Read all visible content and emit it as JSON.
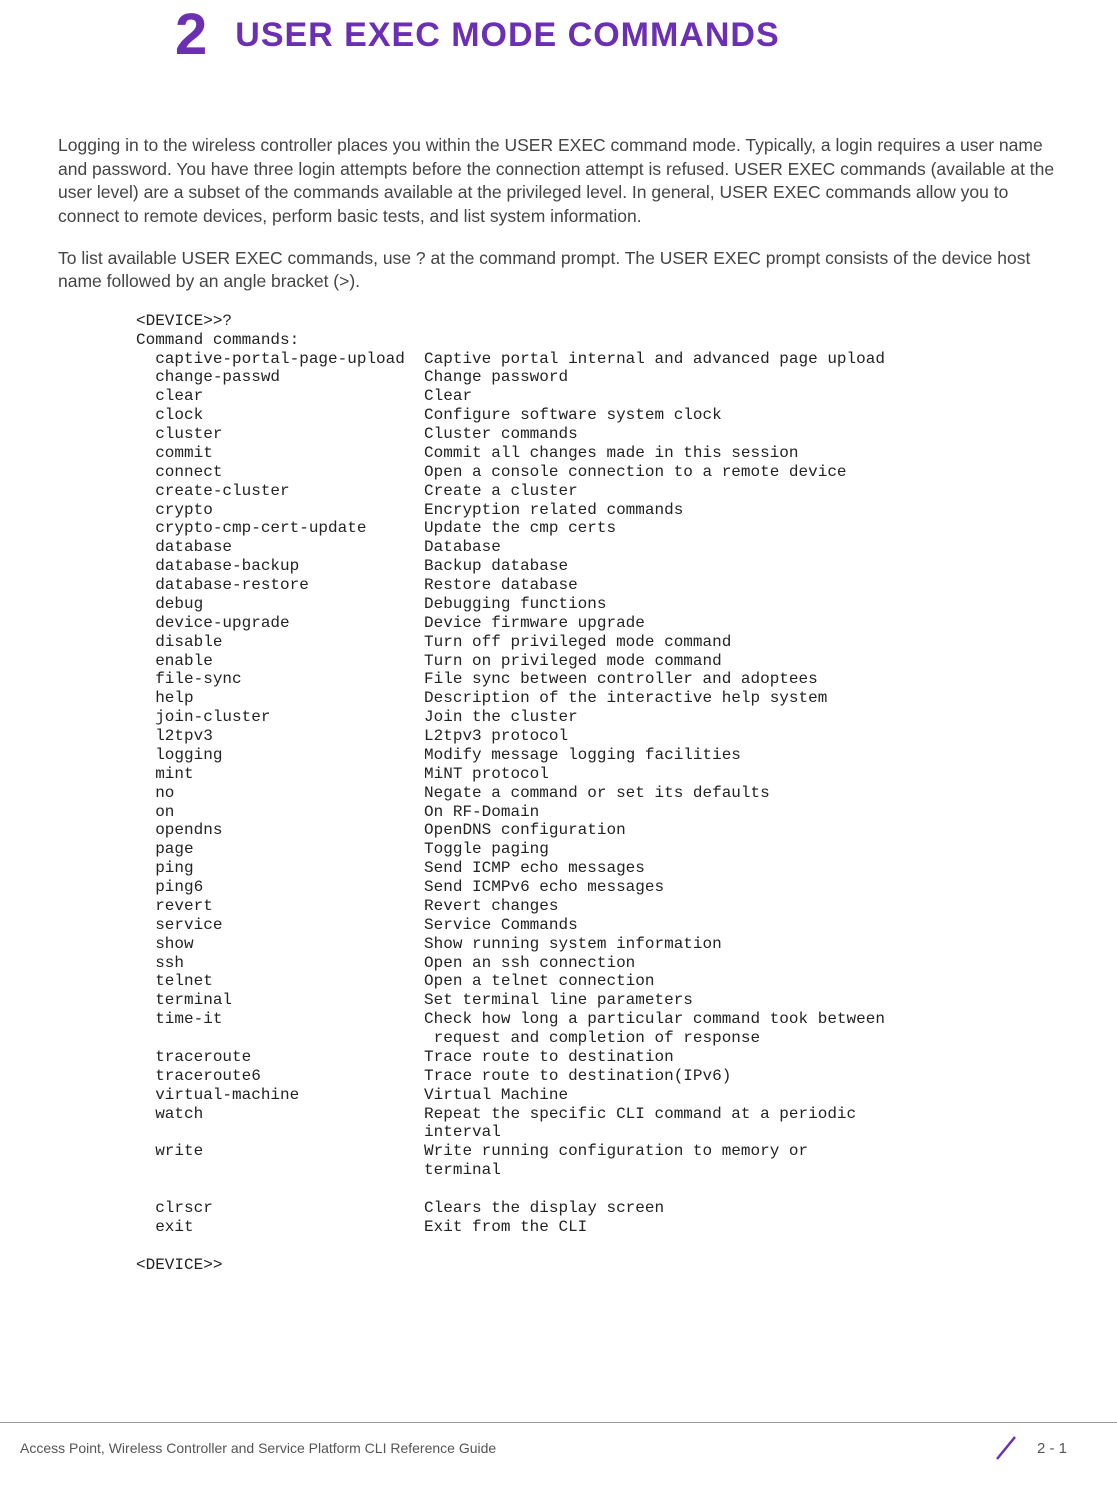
{
  "chapter": {
    "number": "2",
    "title": "USER EXEC MODE COMMANDS"
  },
  "intro": {
    "p1": "Logging in to the wireless controller places you within the USER EXEC command mode. Typically, a login requires a user name and password. You have three login attempts before the connection attempt is refused. USER EXEC commands (available at the user level) are a subset of the commands available at the privileged level. In general, USER EXEC commands allow you to connect to remote devices, perform basic tests, and list system information.",
    "p2": "To list available USER EXEC commands, use ? at the command prompt. The USER EXEC prompt consists of the device host name followed by an angle bracket (>)."
  },
  "cli": {
    "prompt_q": "<DEVICE>>?",
    "heading": "Command commands:",
    "rows": [
      [
        "captive-portal-page-upload",
        "Captive portal internal and advanced page upload"
      ],
      [
        "change-passwd",
        "Change password"
      ],
      [
        "clear",
        "Clear"
      ],
      [
        "clock",
        "Configure software system clock"
      ],
      [
        "cluster",
        "Cluster commands"
      ],
      [
        "commit",
        "Commit all changes made in this session"
      ],
      [
        "connect",
        "Open a console connection to a remote device"
      ],
      [
        "create-cluster",
        "Create a cluster"
      ],
      [
        "crypto",
        "Encryption related commands"
      ],
      [
        "crypto-cmp-cert-update",
        "Update the cmp certs"
      ],
      [
        "database",
        "Database"
      ],
      [
        "database-backup",
        "Backup database"
      ],
      [
        "database-restore",
        "Restore database"
      ],
      [
        "debug",
        "Debugging functions"
      ],
      [
        "device-upgrade",
        "Device firmware upgrade"
      ],
      [
        "disable",
        "Turn off privileged mode command"
      ],
      [
        "enable",
        "Turn on privileged mode command"
      ],
      [
        "file-sync",
        "File sync between controller and adoptees"
      ],
      [
        "help",
        "Description of the interactive help system"
      ],
      [
        "join-cluster",
        "Join the cluster"
      ],
      [
        "l2tpv3",
        "L2tpv3 protocol"
      ],
      [
        "logging",
        "Modify message logging facilities"
      ],
      [
        "mint",
        "MiNT protocol"
      ],
      [
        "no",
        "Negate a command or set its defaults"
      ],
      [
        "on",
        "On RF-Domain"
      ],
      [
        "opendns",
        "OpenDNS configuration"
      ],
      [
        "page",
        "Toggle paging"
      ],
      [
        "ping",
        "Send ICMP echo messages"
      ],
      [
        "ping6",
        "Send ICMPv6 echo messages"
      ],
      [
        "revert",
        "Revert changes"
      ],
      [
        "service",
        "Service Commands"
      ],
      [
        "show",
        "Show running system information"
      ],
      [
        "ssh",
        "Open an ssh connection"
      ],
      [
        "telnet",
        "Open a telnet connection"
      ],
      [
        "terminal",
        "Set terminal line parameters"
      ],
      [
        "time-it",
        "Check how long a particular command took between"
      ],
      [
        "",
        " request and completion of response"
      ],
      [
        "traceroute",
        "Trace route to destination"
      ],
      [
        "traceroute6",
        "Trace route to destination(IPv6)"
      ],
      [
        "virtual-machine",
        "Virtual Machine"
      ],
      [
        "watch",
        "Repeat the specific CLI command at a periodic"
      ],
      [
        "",
        "interval"
      ],
      [
        "write",
        "Write running configuration to memory or"
      ],
      [
        "",
        "terminal"
      ]
    ],
    "extra_rows": [
      [
        "clrscr",
        "Clears the display screen"
      ],
      [
        "exit",
        "Exit from the CLI"
      ]
    ],
    "prompt_end": "<DEVICE>>"
  },
  "footer": {
    "left": "Access Point, Wireless Controller and Service Platform CLI Reference Guide",
    "page": "2 - 1"
  }
}
